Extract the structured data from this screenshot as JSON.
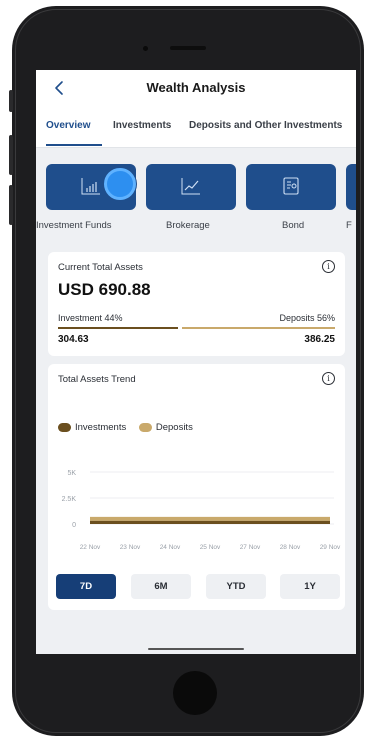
{
  "header": {
    "title": "Wealth Analysis"
  },
  "tabs": [
    {
      "label": "Overview",
      "active": true
    },
    {
      "label": "Investments",
      "active": false
    },
    {
      "label": "Deposits and Other Investments",
      "active": false
    }
  ],
  "categories": [
    {
      "label": "Investment Funds",
      "icon": "bar-chart-icon"
    },
    {
      "label": "Brokerage",
      "icon": "line-chart-icon"
    },
    {
      "label": "Bond",
      "icon": "bond-document-icon"
    },
    {
      "label": "F",
      "icon": "partial-tile"
    }
  ],
  "assets": {
    "label": "Current Total Assets",
    "amount": "USD 690.88",
    "investment_label": "Investment 44%",
    "deposits_label": "Deposits 56%",
    "investment_value": "304.63",
    "deposits_value": "386.25",
    "investment_share": 0.44
  },
  "trend": {
    "label": "Total Assets Trend",
    "legend": [
      {
        "name": "Investments",
        "color": "#6b4f1f"
      },
      {
        "name": "Deposits",
        "color": "#c9a96b"
      }
    ],
    "range_buttons": [
      {
        "label": "7D",
        "active": true
      },
      {
        "label": "6M",
        "active": false
      },
      {
        "label": "YTD",
        "active": false
      },
      {
        "label": "1Y",
        "active": false
      }
    ]
  },
  "chart_data": {
    "type": "area",
    "categories": [
      "22 Nov",
      "23 Nov",
      "24 Nov",
      "25 Nov",
      "27 Nov",
      "28 Nov",
      "29 Nov"
    ],
    "y_ticks": [
      "5K",
      "2.5K",
      "0"
    ],
    "ylim": [
      0,
      5000
    ],
    "series": [
      {
        "name": "Investments",
        "values": [
          304.63,
          304.63,
          304.63,
          304.63,
          304.63,
          304.63,
          304.63
        ]
      },
      {
        "name": "Deposits",
        "values": [
          386.25,
          386.25,
          386.25,
          386.25,
          386.25,
          386.25,
          386.25
        ]
      }
    ],
    "grid": true,
    "legend_position": "top-left"
  },
  "colors": {
    "primary": "#1f4e8c",
    "primary_dark": "#163e77",
    "investment": "#6b4f1f",
    "deposits": "#c9a96b"
  }
}
